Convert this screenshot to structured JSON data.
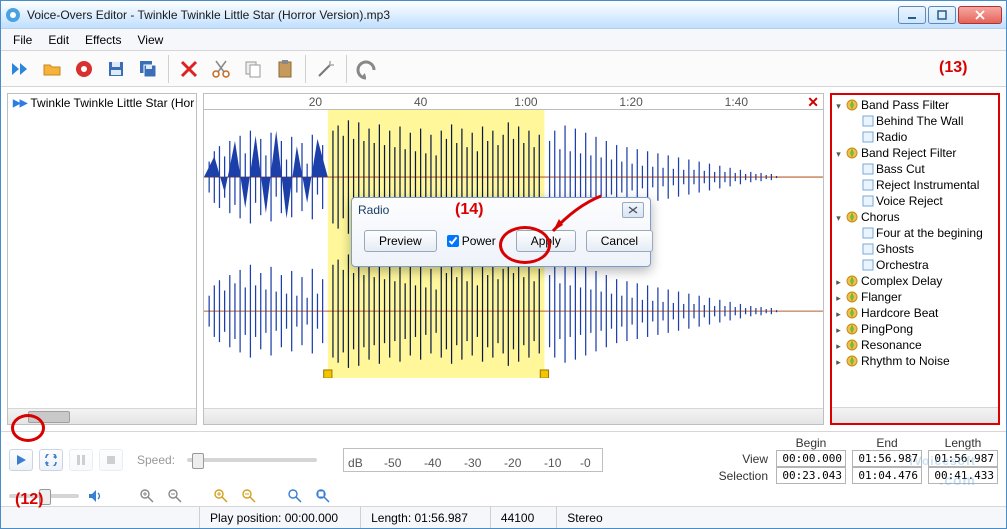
{
  "window": {
    "title": "Voice-Overs Editor - Twinkle Twinkle Little Star (Horror Version).mp3"
  },
  "menu": {
    "file": "File",
    "edit": "Edit",
    "effects": "Effects",
    "view": "View"
  },
  "tracks": {
    "item0": "Twinkle Twinkle Little Star (Hor"
  },
  "ruler": {
    "t20": "20",
    "t40": "40",
    "t100": "1:00",
    "t120": "1:20",
    "t140": "1:40"
  },
  "dialog": {
    "title": "Radio",
    "preview": "Preview",
    "power": "Power",
    "apply": "Apply",
    "cancel": "Cancel"
  },
  "tree": {
    "n0": "Band Pass Filter",
    "n0a": "Behind The Wall",
    "n0b": "Radio",
    "n1": "Band Reject Filter",
    "n1a": "Bass Cut",
    "n1b": "Reject Instrumental",
    "n1c": "Voice Reject",
    "n2": "Chorus",
    "n2a": "Four at the begining",
    "n2b": "Ghosts",
    "n2c": "Orchestra",
    "n3": "Complex Delay",
    "n4": "Flanger",
    "n5": "Hardcore Beat",
    "n6": "PingPong",
    "n7": "Resonance",
    "n8": "Rhythm to Noise"
  },
  "transport": {
    "speed_label": "Speed:"
  },
  "meter": {
    "db": "dB",
    "m50": "-50",
    "m40": "-40",
    "m30": "-30",
    "m20": "-20",
    "m10": "-10",
    "m0": "-0"
  },
  "timetable": {
    "begin": "Begin",
    "end": "End",
    "length": "Length",
    "view_lbl": "View",
    "sel_lbl": "Selection",
    "view_begin": "00:00.000",
    "view_end": "01:56.987",
    "view_len": "01:56.987",
    "sel_begin": "00:23.043",
    "sel_end": "01:04.476",
    "sel_len": "00:41.433"
  },
  "status": {
    "playpos_lbl": "Play position:",
    "playpos": "00:00.000",
    "length_lbl": "Length:",
    "length": "01:56.987",
    "rate": "44100",
    "channels": "Stereo"
  },
  "annotations": {
    "a12": "(12)",
    "a13": "(13)",
    "a14": "(14)"
  },
  "watermark": {
    "text": "iVoicesoft",
    "suffix": ".com"
  }
}
